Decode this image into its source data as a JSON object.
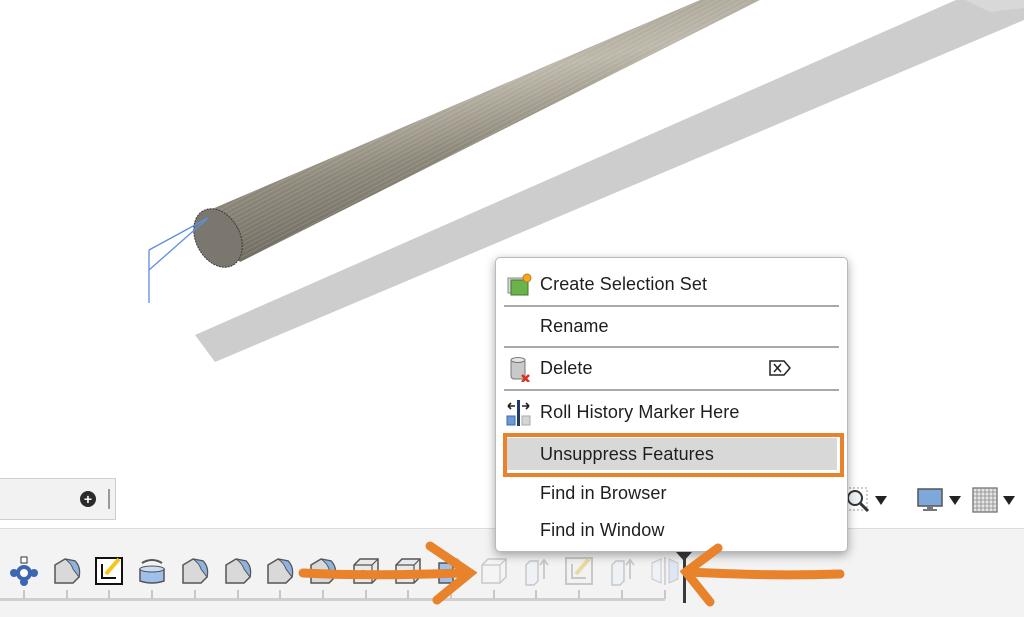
{
  "context_menu": {
    "items": [
      {
        "label": "Create Selection Set",
        "icon": "selection-set-icon"
      },
      {
        "label": "Rename",
        "icon": null
      },
      {
        "label": "Delete",
        "icon": "delete-icon",
        "shortcut_icon": "backspace-delete-key-icon"
      },
      {
        "label": "Roll History Marker Here",
        "icon": "roll-history-marker-icon"
      },
      {
        "label": "Unsuppress Features",
        "icon": null,
        "highlighted": true
      },
      {
        "label": "Find in Browser",
        "icon": null
      },
      {
        "label": "Find in Window",
        "icon": null
      }
    ]
  },
  "browser_panel": {
    "add_icon": "plus-circle-icon"
  },
  "nav_toolbar": {
    "buttons": [
      {
        "icon": "zoom-window-icon",
        "dropdown": true
      },
      {
        "icon": "display-settings-icon",
        "dropdown": true
      },
      {
        "icon": "grid-icon",
        "dropdown": true
      }
    ]
  },
  "timeline": {
    "features": [
      {
        "icon": "joint-origin-icon",
        "suppressed": false
      },
      {
        "icon": "fillet-icon",
        "suppressed": false
      },
      {
        "icon": "sketch-icon",
        "suppressed": false
      },
      {
        "icon": "revolve-icon",
        "suppressed": false
      },
      {
        "icon": "fillet-icon",
        "suppressed": false
      },
      {
        "icon": "fillet-icon",
        "suppressed": false
      },
      {
        "icon": "fillet-icon",
        "suppressed": false
      },
      {
        "icon": "fillet-icon",
        "suppressed": false
      },
      {
        "icon": "hole-icon",
        "suppressed": false
      },
      {
        "icon": "box-icon",
        "suppressed": false
      },
      {
        "icon": "thread-icon",
        "suppressed": false
      },
      {
        "icon": "box-icon",
        "suppressed": true
      },
      {
        "icon": "extrude-icon",
        "suppressed": true
      },
      {
        "icon": "sketch-icon",
        "suppressed": true
      },
      {
        "icon": "extrude-icon",
        "suppressed": true
      },
      {
        "icon": "mirror-icon",
        "suppressed": true
      }
    ],
    "marker_icon": "history-marker-icon"
  },
  "annotation": {
    "accent_color": "#e8832c"
  },
  "colors": {
    "rod": "#8a8478",
    "shadow": "#cccccc",
    "sketch_line": "#5b8fe0"
  }
}
